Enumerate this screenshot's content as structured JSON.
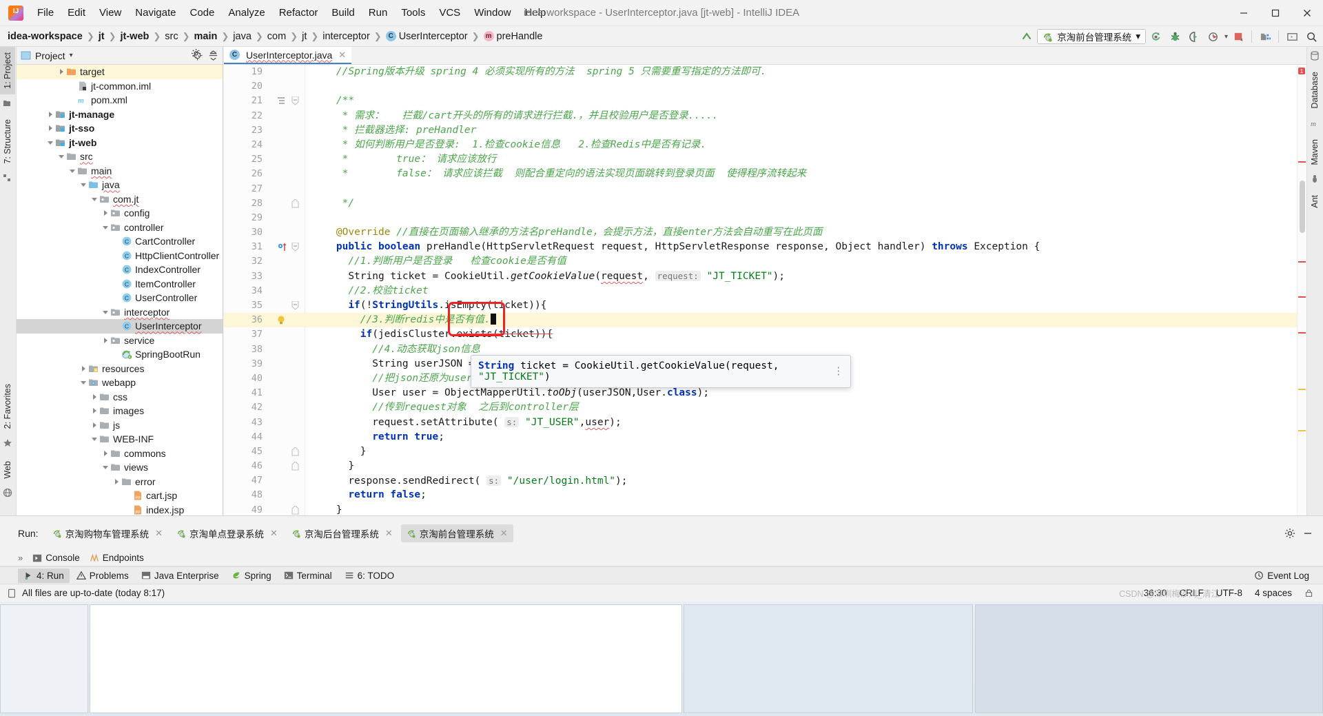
{
  "window": {
    "title": "idea-workspace - UserInterceptor.java [jt-web] - IntelliJ IDEA",
    "minimize": "—",
    "maximize": "❐",
    "close": "✕",
    "logo_text": "IJ"
  },
  "menubar": [
    {
      "label": "File"
    },
    {
      "label": "Edit"
    },
    {
      "label": "View"
    },
    {
      "label": "Navigate"
    },
    {
      "label": "Code"
    },
    {
      "label": "Analyze"
    },
    {
      "label": "Refactor"
    },
    {
      "label": "Build"
    },
    {
      "label": "Run"
    },
    {
      "label": "Tools"
    },
    {
      "label": "VCS"
    },
    {
      "label": "Window"
    },
    {
      "label": "Help"
    }
  ],
  "breadcrumb": [
    {
      "label": "idea-workspace",
      "bold": true,
      "icon": "none"
    },
    {
      "label": "jt",
      "bold": true,
      "icon": "none"
    },
    {
      "label": "jt-web",
      "bold": true,
      "icon": "none"
    },
    {
      "label": "src",
      "bold": false,
      "icon": "none"
    },
    {
      "label": "main",
      "bold": true,
      "icon": "none"
    },
    {
      "label": "java",
      "bold": false,
      "icon": "none"
    },
    {
      "label": "com",
      "bold": false,
      "icon": "none"
    },
    {
      "label": "jt",
      "bold": false,
      "icon": "none"
    },
    {
      "label": "interceptor",
      "bold": false,
      "icon": "none"
    },
    {
      "label": "UserInterceptor",
      "bold": false,
      "icon": "class"
    },
    {
      "label": "preHandle",
      "bold": false,
      "icon": "method"
    }
  ],
  "toolbar": {
    "run_config_label": "京淘前台管理系统",
    "run_config_caret": "▾",
    "icons": [
      {
        "name": "rerun-icon"
      },
      {
        "name": "debug-icon"
      },
      {
        "name": "run-with-coverage-icon"
      },
      {
        "name": "profiler-icon"
      },
      {
        "name": "stop-icon"
      },
      {
        "name": "project-structure-icon"
      },
      {
        "name": "terminal-icon"
      },
      {
        "name": "search-everywhere-icon"
      }
    ]
  },
  "left_strip": [
    {
      "label": "1: Project",
      "active": true
    },
    {
      "label": "7: Structure",
      "active": false
    },
    {
      "label": "2: Favorites",
      "active": false
    },
    {
      "label": "Web",
      "active": false
    }
  ],
  "right_strip": [
    {
      "label": "Database"
    },
    {
      "label": "Maven"
    },
    {
      "label": "Ant"
    }
  ],
  "project_panel": {
    "title": "Project",
    "title_caret": "▾",
    "locate_icon": "locate-icon",
    "collapse_icon": "collapse-all-icon",
    "minimize_icon": "minimize-icon",
    "settings_icon": "gear-icon",
    "tree": [
      {
        "label": "target",
        "indent": 4,
        "twisty": "closed",
        "icon": "folder-orange",
        "highlight": "yellow",
        "bold": false
      },
      {
        "label": "jt-common.iml",
        "indent": 5,
        "twisty": "none",
        "icon": "iml",
        "highlight": "none",
        "bold": false
      },
      {
        "label": "pom.xml",
        "indent": 5,
        "twisty": "none",
        "icon": "maven",
        "highlight": "none",
        "bold": false
      },
      {
        "label": "jt-manage",
        "indent": 3,
        "twisty": "closed",
        "icon": "module",
        "highlight": "none",
        "bold": true
      },
      {
        "label": "jt-sso",
        "indent": 3,
        "twisty": "closed",
        "icon": "module",
        "highlight": "none",
        "bold": true
      },
      {
        "label": "jt-web",
        "indent": 3,
        "twisty": "open",
        "icon": "module",
        "highlight": "none",
        "bold": true
      },
      {
        "label": "src",
        "indent": 4,
        "twisty": "open",
        "icon": "folder-grey",
        "highlight": "none",
        "bold": false,
        "squiggle": true
      },
      {
        "label": "main",
        "indent": 5,
        "twisty": "open",
        "icon": "folder-grey",
        "highlight": "none",
        "bold": false,
        "squiggle": true
      },
      {
        "label": "java",
        "indent": 6,
        "twisty": "open",
        "icon": "folder-source",
        "highlight": "none",
        "bold": false,
        "squiggle": true
      },
      {
        "label": "com.jt",
        "indent": 7,
        "twisty": "open",
        "icon": "package",
        "highlight": "none",
        "bold": false,
        "squiggle": true
      },
      {
        "label": "config",
        "indent": 8,
        "twisty": "closed",
        "icon": "package",
        "highlight": "none",
        "bold": false
      },
      {
        "label": "controller",
        "indent": 8,
        "twisty": "open",
        "icon": "package",
        "highlight": "none",
        "bold": false
      },
      {
        "label": "CartController",
        "indent": 9,
        "twisty": "none",
        "icon": "class",
        "highlight": "none",
        "bold": false
      },
      {
        "label": "HttpClientController",
        "indent": 9,
        "twisty": "none",
        "icon": "class",
        "highlight": "none",
        "bold": false
      },
      {
        "label": "IndexController",
        "indent": 9,
        "twisty": "none",
        "icon": "class",
        "highlight": "none",
        "bold": false
      },
      {
        "label": "ItemController",
        "indent": 9,
        "twisty": "none",
        "icon": "class",
        "highlight": "none",
        "bold": false
      },
      {
        "label": "UserController",
        "indent": 9,
        "twisty": "none",
        "icon": "class",
        "highlight": "none",
        "bold": false
      },
      {
        "label": "interceptor",
        "indent": 8,
        "twisty": "open",
        "icon": "package",
        "highlight": "none",
        "bold": false,
        "squiggle": true
      },
      {
        "label": "UserInterceptor",
        "indent": 9,
        "twisty": "none",
        "icon": "class",
        "highlight": "grey",
        "bold": false,
        "squiggle": true
      },
      {
        "label": "service",
        "indent": 8,
        "twisty": "closed",
        "icon": "package",
        "highlight": "none",
        "bold": false
      },
      {
        "label": "SpringBootRun",
        "indent": 9,
        "twisty": "none",
        "icon": "springboot",
        "highlight": "none",
        "bold": false
      },
      {
        "label": "resources",
        "indent": 6,
        "twisty": "closed",
        "icon": "folder-resources",
        "highlight": "none",
        "bold": false
      },
      {
        "label": "webapp",
        "indent": 6,
        "twisty": "open",
        "icon": "folder-webapp",
        "highlight": "none",
        "bold": false
      },
      {
        "label": "css",
        "indent": 7,
        "twisty": "closed",
        "icon": "folder-grey",
        "highlight": "none",
        "bold": false
      },
      {
        "label": "images",
        "indent": 7,
        "twisty": "closed",
        "icon": "folder-grey",
        "highlight": "none",
        "bold": false
      },
      {
        "label": "js",
        "indent": 7,
        "twisty": "closed",
        "icon": "folder-grey",
        "highlight": "none",
        "bold": false
      },
      {
        "label": "WEB-INF",
        "indent": 7,
        "twisty": "open",
        "icon": "folder-grey",
        "highlight": "none",
        "bold": false
      },
      {
        "label": "commons",
        "indent": 8,
        "twisty": "closed",
        "icon": "folder-grey",
        "highlight": "none",
        "bold": false
      },
      {
        "label": "views",
        "indent": 8,
        "twisty": "open",
        "icon": "folder-grey",
        "highlight": "none",
        "bold": false
      },
      {
        "label": "error",
        "indent": 9,
        "twisty": "closed",
        "icon": "folder-grey",
        "highlight": "none",
        "bold": false
      },
      {
        "label": "cart.jsp",
        "indent": 10,
        "twisty": "none",
        "icon": "jsp",
        "highlight": "none",
        "bold": false
      },
      {
        "label": "index.jsp",
        "indent": 10,
        "twisty": "none",
        "icon": "jsp",
        "highlight": "none",
        "bold": false
      }
    ]
  },
  "editor": {
    "tab": {
      "label": "UserInterceptor.java",
      "icon": "class",
      "close": "✕"
    },
    "lines": [
      {
        "n": "19",
        "indent": 2,
        "segments": [
          {
            "t": "//Spring版本升级 spring 4 必须实现所有的方法  spring 5 只需要重写指定的方法即可.",
            "c": "cm"
          }
        ]
      },
      {
        "n": "20",
        "indent": 0,
        "segments": []
      },
      {
        "n": "21",
        "indent": 2,
        "fold": "open",
        "gutterIcon": "docs",
        "segments": [
          {
            "t": "/**",
            "c": "cm"
          }
        ]
      },
      {
        "n": "22",
        "indent": 2,
        "segments": [
          {
            "t": " * 需求：   拦截/cart开头的所有的请求进行拦截.，并且校验用户是否登录.....",
            "c": "cm"
          }
        ]
      },
      {
        "n": "23",
        "indent": 2,
        "segments": [
          {
            "t": " * 拦截器选择: preHandler",
            "c": "cm"
          }
        ]
      },
      {
        "n": "24",
        "indent": 2,
        "segments": [
          {
            "t": " * 如何判断用户是否登录:  1.检查cookie信息   2.检查Redis中是否有记录.",
            "c": "cm"
          }
        ]
      },
      {
        "n": "25",
        "indent": 2,
        "segments": [
          {
            "t": " *        true： 请求应该放行",
            "c": "cm"
          }
        ]
      },
      {
        "n": "26",
        "indent": 2,
        "segments": [
          {
            "t": " *        false： 请求应该拦截  则配合重定向的语法实现页面跳转到登录页面  使得程序流转起来",
            "c": "cm"
          }
        ]
      },
      {
        "n": "27",
        "indent": 0,
        "segments": []
      },
      {
        "n": "28",
        "indent": 2,
        "fold": "end",
        "segments": [
          {
            "t": " */",
            "c": "cm"
          }
        ]
      },
      {
        "n": "29",
        "indent": 0,
        "segments": []
      },
      {
        "n": "30",
        "indent": 2,
        "segments": [
          {
            "t": "@Override ",
            "c": "ann"
          },
          {
            "t": "//直接在页面输入继承的方法名preHandle，会提示方法，直接enter方法会自动重写在此页面",
            "c": "cm"
          }
        ]
      },
      {
        "n": "31",
        "indent": 2,
        "fold": "open",
        "gutterIcon": "override",
        "segments": [
          {
            "t": "public boolean ",
            "c": "kw"
          },
          {
            "t": "preHandle",
            "c": "plain"
          },
          {
            "t": "(",
            "c": "plain"
          },
          {
            "t": "HttpServletRequest ",
            "c": "plain"
          },
          {
            "t": "request, ",
            "c": "plain"
          },
          {
            "t": "HttpServletResponse ",
            "c": "plain"
          },
          {
            "t": "response, ",
            "c": "plain"
          },
          {
            "t": "Object ",
            "c": "plain"
          },
          {
            "t": "handler) ",
            "c": "plain"
          },
          {
            "t": "throws ",
            "c": "kw"
          },
          {
            "t": "Exception {",
            "c": "plain"
          }
        ]
      },
      {
        "n": "32",
        "indent": 3,
        "segments": [
          {
            "t": "//1.判断用户是否登录   检查cookie是否有值",
            "c": "cm"
          }
        ]
      },
      {
        "n": "33",
        "indent": 3,
        "segments": [
          {
            "t": "String ticket = CookieUtil.",
            "c": "plain"
          },
          {
            "t": "getCookieValue",
            "c": "mth"
          },
          {
            "t": "(",
            "c": "plain"
          },
          {
            "t": "request",
            "c": "errp"
          },
          {
            "t": ", ",
            "c": "plain"
          },
          {
            "t": "request:",
            "c": "hint"
          },
          {
            "t": " \"JT_TICKET\"",
            "c": "str"
          },
          {
            "t": ");",
            "c": "plain"
          }
        ]
      },
      {
        "n": "34",
        "indent": 3,
        "segments": [
          {
            "t": "//2.校验ticket",
            "c": "cm"
          }
        ]
      },
      {
        "n": "35",
        "indent": 3,
        "fold": "open",
        "segments": [
          {
            "t": "if",
            "c": "kw"
          },
          {
            "t": "(!",
            "c": "plain"
          },
          {
            "t": "StringUtils",
            "c": "cls"
          },
          {
            "t": ".isEmpty(ticket)){",
            "c": "plain"
          }
        ]
      },
      {
        "n": "36",
        "indent": 4,
        "highlight": true,
        "gutterIcon": "bulb",
        "segments": [
          {
            "t": "//3.判断redis中是否有值.",
            "c": "cm"
          },
          {
            "t": "CARET",
            "c": "caret"
          }
        ]
      },
      {
        "n": "37",
        "indent": 4,
        "segments": [
          {
            "t": "if",
            "c": "kw"
          },
          {
            "t": "(jedisCluster.",
            "c": "plain"
          },
          {
            "t": "exists",
            "c": "strike"
          },
          {
            "t": "(ticket)){",
            "c": "strike2"
          }
        ]
      },
      {
        "n": "38",
        "indent": 5,
        "segments": [
          {
            "t": "//4.动态获取json信息",
            "c": "cm"
          }
        ]
      },
      {
        "n": "39",
        "indent": 5,
        "segments": [
          {
            "t": "String userJSON = j",
            "c": "plain"
          }
        ]
      },
      {
        "n": "40",
        "indent": 5,
        "segments": [
          {
            "t": "//把json还原为user对象",
            "c": "cm"
          }
        ]
      },
      {
        "n": "41",
        "indent": 5,
        "segments": [
          {
            "t": "User ",
            "c": "cls2"
          },
          {
            "t": "user = ObjectMapperUtil.",
            "c": "plain"
          },
          {
            "t": "toObj",
            "c": "mth"
          },
          {
            "t": "(userJSON,User.",
            "c": "plain"
          },
          {
            "t": "class",
            "c": "kw"
          },
          {
            "t": ");",
            "c": "plain"
          }
        ]
      },
      {
        "n": "42",
        "indent": 5,
        "segments": [
          {
            "t": "//传到request对象  之后到controller层",
            "c": "cm"
          }
        ]
      },
      {
        "n": "43",
        "indent": 5,
        "segments": [
          {
            "t": "request.setAttribute( ",
            "c": "plain"
          },
          {
            "t": "s:",
            "c": "hint"
          },
          {
            "t": " \"JT_USER\"",
            "c": "str"
          },
          {
            "t": ",",
            "c": "plain"
          },
          {
            "t": "user",
            "c": "errp"
          },
          {
            "t": ");",
            "c": "plain"
          }
        ]
      },
      {
        "n": "44",
        "indent": 5,
        "segments": [
          {
            "t": "return true",
            "c": "kw"
          },
          {
            "t": ";",
            "c": "plain"
          }
        ]
      },
      {
        "n": "45",
        "indent": 4,
        "fold": "end",
        "segments": [
          {
            "t": "}",
            "c": "plain"
          }
        ]
      },
      {
        "n": "46",
        "indent": 3,
        "fold": "end",
        "segments": [
          {
            "t": "}",
            "c": "plain"
          }
        ]
      },
      {
        "n": "47",
        "indent": 3,
        "segments": [
          {
            "t": "response.sendRedirect( ",
            "c": "plain"
          },
          {
            "t": "s:",
            "c": "hint"
          },
          {
            "t": " \"/user/login.html\"",
            "c": "str"
          },
          {
            "t": ");",
            "c": "plain"
          }
        ]
      },
      {
        "n": "48",
        "indent": 3,
        "segments": [
          {
            "t": "return false",
            "c": "kw"
          },
          {
            "t": ";",
            "c": "plain"
          }
        ]
      },
      {
        "n": "49",
        "indent": 2,
        "fold": "end",
        "segments": [
          {
            "t": "}",
            "c": "plain"
          }
        ]
      }
    ],
    "doc_popup": {
      "text": "String ticket = CookieUtil.getCookieValue(request, \"JT_TICKET\")",
      "more": "⋮"
    },
    "annotation_box": {
      "name": "red-highlight-box"
    },
    "error_badge": "1"
  },
  "run_panel": {
    "label": "Run:",
    "tabs": [
      {
        "label": "京淘购物车管理系统",
        "active": false,
        "close": "✕"
      },
      {
        "label": "京淘单点登录系统",
        "active": false,
        "close": "✕"
      },
      {
        "label": "京淘后台管理系统",
        "active": false,
        "close": "✕"
      },
      {
        "label": "京淘前台管理系统",
        "active": true,
        "close": "✕"
      }
    ],
    "settings_icon": "gear-icon",
    "minimize_icon": "minimize-icon"
  },
  "sub_tabs": {
    "expand": "»",
    "items": [
      {
        "label": "Console",
        "icon": "console-icon"
      },
      {
        "label": "Endpoints",
        "icon": "endpoints-icon"
      }
    ]
  },
  "bottom_bar": {
    "items": [
      {
        "label": "4: Run",
        "icon": "run-icon",
        "active": true
      },
      {
        "label": "Problems",
        "icon": "problems-icon",
        "active": false
      },
      {
        "label": "Java Enterprise",
        "icon": "java-enterprise-icon",
        "active": false
      },
      {
        "label": "Spring",
        "icon": "spring-icon",
        "active": false
      },
      {
        "label": "Terminal",
        "icon": "terminal-icon",
        "active": false
      },
      {
        "label": "6: TODO",
        "icon": "todo-icon",
        "active": false
      }
    ],
    "event_log": {
      "label": "Event Log",
      "icon": "event-log-icon"
    }
  },
  "status_bar": {
    "message": "All files are up-to-date (today 8:17)",
    "caret_position": "36:30",
    "line_separator": "CRLF",
    "encoding": "UTF-8",
    "indent": "4 spaces",
    "watermark": "CSDN @深圳梅沙湾_清江"
  }
}
